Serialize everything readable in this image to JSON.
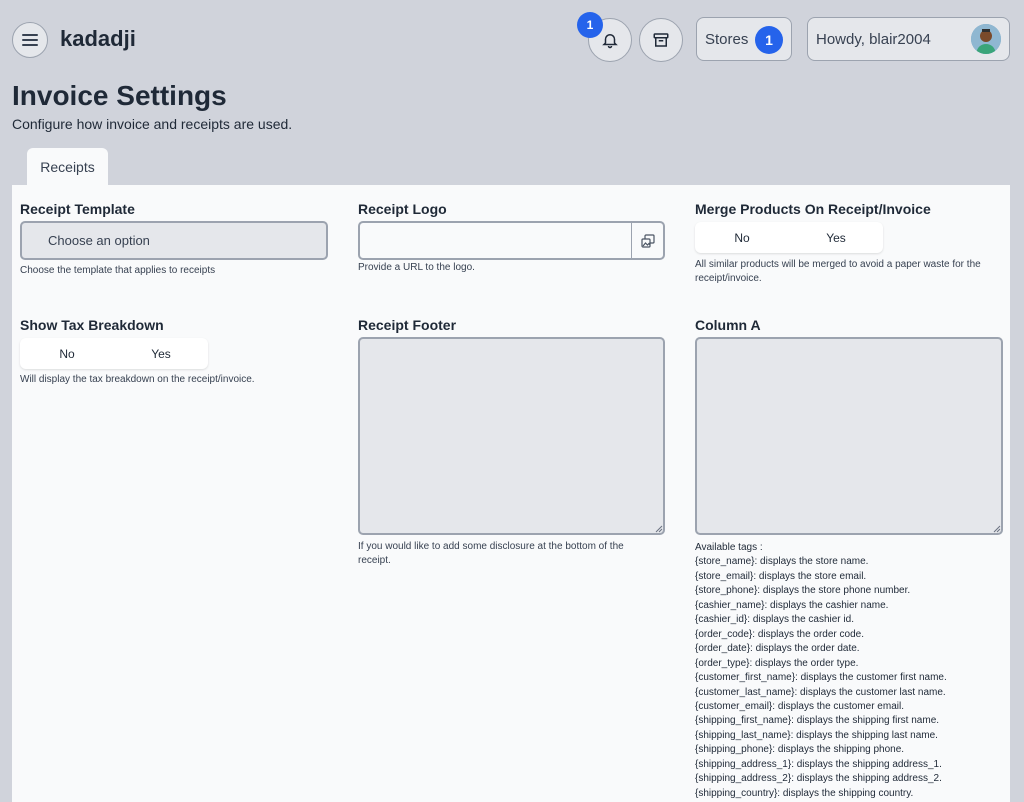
{
  "app": {
    "brand": "kadadji"
  },
  "header": {
    "notifications_count": "1",
    "stores_label": "Stores",
    "stores_count": "1",
    "user_greeting": "Howdy, blair2004"
  },
  "page": {
    "title": "Invoice Settings",
    "subtitle": "Configure how invoice and receipts are used."
  },
  "tabs": [
    {
      "label": "Receipts"
    }
  ],
  "fields": {
    "receipt_template": {
      "label": "Receipt Template",
      "value": "Choose an option",
      "help": "Choose the template that applies to receipts"
    },
    "receipt_logo": {
      "label": "Receipt Logo",
      "value": "",
      "help": "Provide a URL to the logo."
    },
    "merge_products": {
      "label": "Merge Products On Receipt/Invoice",
      "options": [
        "No",
        "Yes"
      ],
      "help_line1": "All similar products will be merged to avoid a paper waste for the",
      "help_line2": "receipt/invoice."
    },
    "show_tax": {
      "label": "Show Tax Breakdown",
      "options": [
        "No",
        "Yes"
      ],
      "help": "Will display the tax breakdown on the receipt/invoice."
    },
    "receipt_footer": {
      "label": "Receipt Footer",
      "value": "",
      "help_line1": "If you would like to add some disclosure at the bottom of the",
      "help_line2": "receipt."
    },
    "column_a": {
      "label": "Column A",
      "value": "",
      "tags_title": "Available tags :",
      "tags": [
        "{store_name}: displays the store name.",
        "{store_email}: displays the store email.",
        "{store_phone}: displays the store phone number.",
        "{cashier_name}: displays the cashier name.",
        "{cashier_id}: displays the cashier id.",
        "{order_code}: displays the order code.",
        "{order_date}: displays the order date.",
        "{order_type}: displays the order type.",
        "{customer_first_name}: displays the customer first name.",
        "{customer_last_name}: displays the customer last name.",
        "{customer_email}: displays the customer email.",
        "{shipping_first_name}: displays the shipping first name.",
        "{shipping_last_name}: displays the shipping last name.",
        "{shipping_phone}: displays the shipping phone.",
        "{shipping_address_1}: displays the shipping address_1.",
        "{shipping_address_2}: displays the shipping address_2.",
        "{shipping_country}: displays the shipping country."
      ]
    }
  },
  "colors": {
    "badge": "#2563eb",
    "background": "#d0d3db",
    "panel": "#f9fafb"
  },
  "icons": [
    "hamburger-icon",
    "bell-icon",
    "store-icon",
    "image-picker-icon",
    "avatar"
  ]
}
